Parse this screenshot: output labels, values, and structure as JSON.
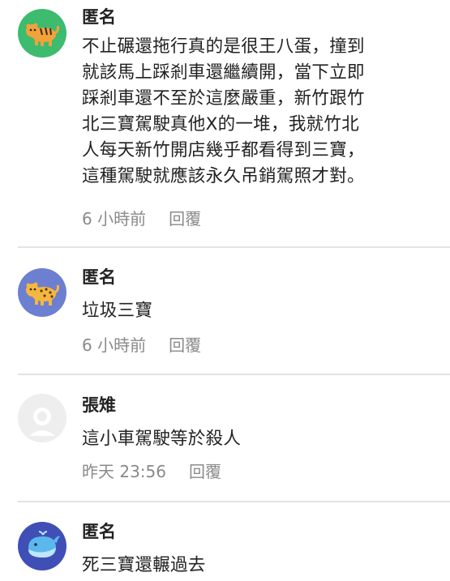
{
  "comments": [
    {
      "author": "匿名",
      "avatar": "tiger-icon",
      "avatar_bg": "#3dbb6f",
      "lines": [
        "不止碾還拖行真的是很王八蛋，撞到",
        "就該馬上踩剎車還繼續開，當下立即",
        "踩剎車還不至於這麼嚴重，新竹跟竹",
        "北三寶駕駛真他X的一堆，我就竹北",
        "人每天新竹開店幾乎都看得到三寶，",
        "這種駕駛就應該永久吊銷駕照才對。"
      ],
      "time": "6 小時前",
      "reply_label": "回覆"
    },
    {
      "author": "匿名",
      "avatar": "leopard-icon",
      "avatar_bg": "#6d7fd0",
      "lines": [
        "垃圾三寶"
      ],
      "time": "6 小時前",
      "reply_label": "回覆"
    },
    {
      "author": "張雉",
      "avatar": "default-user-icon",
      "avatar_bg": "#eeeeee",
      "lines": [
        "這小車駕駛等於殺人"
      ],
      "time": "昨天 23:56",
      "reply_label": "回覆"
    },
    {
      "author": "匿名",
      "avatar": "whale-icon",
      "avatar_bg": "#3f4fb6",
      "lines": [
        "死三寶還輾過去"
      ],
      "time": "",
      "reply_label": ""
    }
  ]
}
